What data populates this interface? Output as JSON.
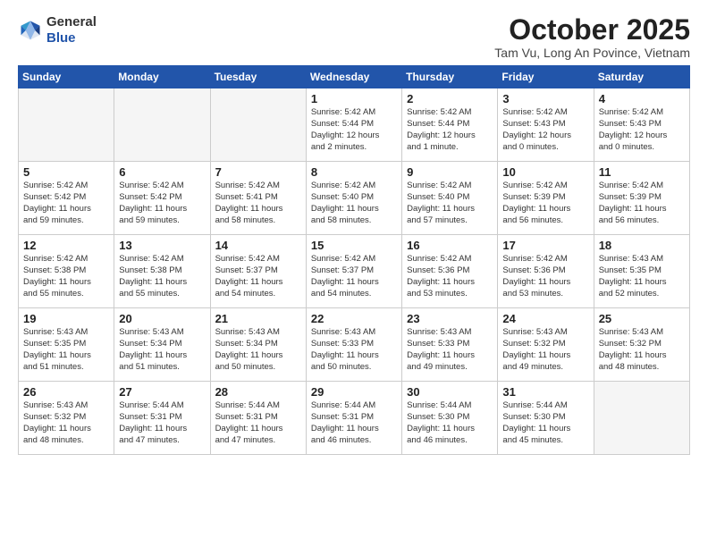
{
  "header": {
    "logo": {
      "general": "General",
      "blue": "Blue"
    },
    "month": "October 2025",
    "location": "Tam Vu, Long An Povince, Vietnam"
  },
  "days_of_week": [
    "Sunday",
    "Monday",
    "Tuesday",
    "Wednesday",
    "Thursday",
    "Friday",
    "Saturday"
  ],
  "weeks": [
    [
      {
        "day": "",
        "content": ""
      },
      {
        "day": "",
        "content": ""
      },
      {
        "day": "",
        "content": ""
      },
      {
        "day": "1",
        "content": "Sunrise: 5:42 AM\nSunset: 5:44 PM\nDaylight: 12 hours\nand 2 minutes."
      },
      {
        "day": "2",
        "content": "Sunrise: 5:42 AM\nSunset: 5:44 PM\nDaylight: 12 hours\nand 1 minute."
      },
      {
        "day": "3",
        "content": "Sunrise: 5:42 AM\nSunset: 5:43 PM\nDaylight: 12 hours\nand 0 minutes."
      },
      {
        "day": "4",
        "content": "Sunrise: 5:42 AM\nSunset: 5:43 PM\nDaylight: 12 hours\nand 0 minutes."
      }
    ],
    [
      {
        "day": "5",
        "content": "Sunrise: 5:42 AM\nSunset: 5:42 PM\nDaylight: 11 hours\nand 59 minutes."
      },
      {
        "day": "6",
        "content": "Sunrise: 5:42 AM\nSunset: 5:42 PM\nDaylight: 11 hours\nand 59 minutes."
      },
      {
        "day": "7",
        "content": "Sunrise: 5:42 AM\nSunset: 5:41 PM\nDaylight: 11 hours\nand 58 minutes."
      },
      {
        "day": "8",
        "content": "Sunrise: 5:42 AM\nSunset: 5:40 PM\nDaylight: 11 hours\nand 58 minutes."
      },
      {
        "day": "9",
        "content": "Sunrise: 5:42 AM\nSunset: 5:40 PM\nDaylight: 11 hours\nand 57 minutes."
      },
      {
        "day": "10",
        "content": "Sunrise: 5:42 AM\nSunset: 5:39 PM\nDaylight: 11 hours\nand 56 minutes."
      },
      {
        "day": "11",
        "content": "Sunrise: 5:42 AM\nSunset: 5:39 PM\nDaylight: 11 hours\nand 56 minutes."
      }
    ],
    [
      {
        "day": "12",
        "content": "Sunrise: 5:42 AM\nSunset: 5:38 PM\nDaylight: 11 hours\nand 55 minutes."
      },
      {
        "day": "13",
        "content": "Sunrise: 5:42 AM\nSunset: 5:38 PM\nDaylight: 11 hours\nand 55 minutes."
      },
      {
        "day": "14",
        "content": "Sunrise: 5:42 AM\nSunset: 5:37 PM\nDaylight: 11 hours\nand 54 minutes."
      },
      {
        "day": "15",
        "content": "Sunrise: 5:42 AM\nSunset: 5:37 PM\nDaylight: 11 hours\nand 54 minutes."
      },
      {
        "day": "16",
        "content": "Sunrise: 5:42 AM\nSunset: 5:36 PM\nDaylight: 11 hours\nand 53 minutes."
      },
      {
        "day": "17",
        "content": "Sunrise: 5:42 AM\nSunset: 5:36 PM\nDaylight: 11 hours\nand 53 minutes."
      },
      {
        "day": "18",
        "content": "Sunrise: 5:43 AM\nSunset: 5:35 PM\nDaylight: 11 hours\nand 52 minutes."
      }
    ],
    [
      {
        "day": "19",
        "content": "Sunrise: 5:43 AM\nSunset: 5:35 PM\nDaylight: 11 hours\nand 51 minutes."
      },
      {
        "day": "20",
        "content": "Sunrise: 5:43 AM\nSunset: 5:34 PM\nDaylight: 11 hours\nand 51 minutes."
      },
      {
        "day": "21",
        "content": "Sunrise: 5:43 AM\nSunset: 5:34 PM\nDaylight: 11 hours\nand 50 minutes."
      },
      {
        "day": "22",
        "content": "Sunrise: 5:43 AM\nSunset: 5:33 PM\nDaylight: 11 hours\nand 50 minutes."
      },
      {
        "day": "23",
        "content": "Sunrise: 5:43 AM\nSunset: 5:33 PM\nDaylight: 11 hours\nand 49 minutes."
      },
      {
        "day": "24",
        "content": "Sunrise: 5:43 AM\nSunset: 5:32 PM\nDaylight: 11 hours\nand 49 minutes."
      },
      {
        "day": "25",
        "content": "Sunrise: 5:43 AM\nSunset: 5:32 PM\nDaylight: 11 hours\nand 48 minutes."
      }
    ],
    [
      {
        "day": "26",
        "content": "Sunrise: 5:43 AM\nSunset: 5:32 PM\nDaylight: 11 hours\nand 48 minutes."
      },
      {
        "day": "27",
        "content": "Sunrise: 5:44 AM\nSunset: 5:31 PM\nDaylight: 11 hours\nand 47 minutes."
      },
      {
        "day": "28",
        "content": "Sunrise: 5:44 AM\nSunset: 5:31 PM\nDaylight: 11 hours\nand 47 minutes."
      },
      {
        "day": "29",
        "content": "Sunrise: 5:44 AM\nSunset: 5:31 PM\nDaylight: 11 hours\nand 46 minutes."
      },
      {
        "day": "30",
        "content": "Sunrise: 5:44 AM\nSunset: 5:30 PM\nDaylight: 11 hours\nand 46 minutes."
      },
      {
        "day": "31",
        "content": "Sunrise: 5:44 AM\nSunset: 5:30 PM\nDaylight: 11 hours\nand 45 minutes."
      },
      {
        "day": "",
        "content": ""
      }
    ]
  ]
}
